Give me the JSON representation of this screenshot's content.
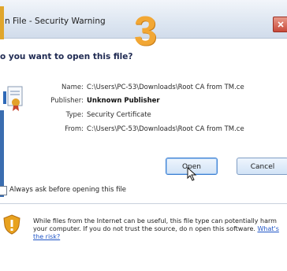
{
  "dialog": {
    "title": "n File - Security Warning",
    "step_number": "3",
    "question": "o you want to open this file?"
  },
  "details": [
    {
      "label": "Name:",
      "value": "C:\\Users\\PC-53\\Downloads\\Root CA from TM.ce",
      "bold": false
    },
    {
      "label": "Publisher:",
      "value": "Unknown Publisher",
      "bold": true
    },
    {
      "label": "Type:",
      "value": "Security Certificate",
      "bold": false
    },
    {
      "label": "From:",
      "value": "C:\\Users\\PC-53\\Downloads\\Root CA from TM.ce",
      "bold": false
    }
  ],
  "buttons": {
    "open_label": "Open",
    "cancel_label": "Cancel"
  },
  "checkbox": {
    "label": "Always ask before opening this file",
    "checked": false
  },
  "warning": {
    "text": "While files from the Internet can be useful, this file type can potentially harm your computer. If you do not trust the source, do n open this software.",
    "link_text": "What's the risk?"
  },
  "icons": [
    "certificate-file-icon",
    "close-icon",
    "mouse-cursor-icon",
    "warning-shield-icon"
  ],
  "colors": {
    "step_number": "#f2a734",
    "question_text": "#1f2a52",
    "link": "#1f55c6",
    "close_button": "#c84a3a"
  }
}
